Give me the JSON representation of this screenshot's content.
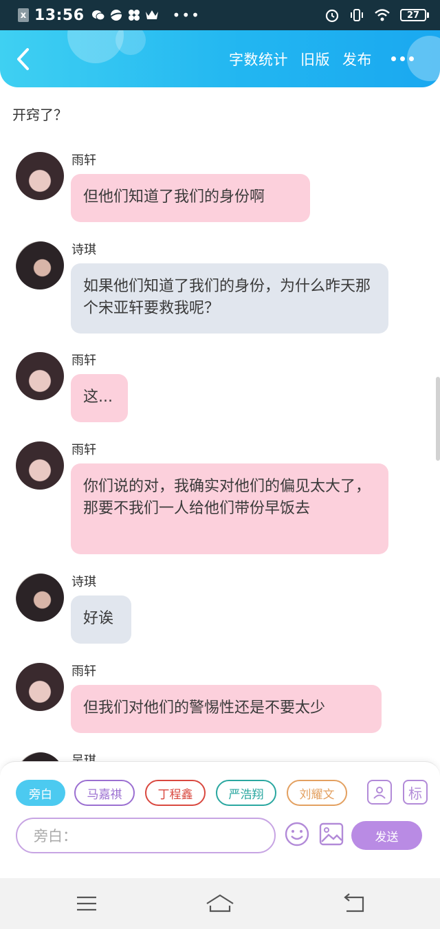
{
  "status_bar": {
    "time": "13:56",
    "battery": "27",
    "icons": [
      "close-box-icon",
      "wechat-icon",
      "planet-icon",
      "flower-icon",
      "crown-icon",
      "more-dots-icon",
      "alarm-icon",
      "vibrate-icon",
      "wifi-icon",
      "battery-icon"
    ]
  },
  "header": {
    "actions": [
      "字数统计",
      "旧版",
      "发布"
    ]
  },
  "chat": {
    "intro": "开窍了？",
    "messages": [
      {
        "sender": "雨轩",
        "text": "但他们知道了我们的身份啊",
        "style": "pink"
      },
      {
        "sender": "诗琪",
        "text": "如果他们知道了我们的身份，为什么昨天那个宋亚轩要救我呢？",
        "style": "gray"
      },
      {
        "sender": "雨轩",
        "text": "这...",
        "style": "pink"
      },
      {
        "sender": "雨轩",
        "text": "你们说的对，我确实对他们的偏见太大了，那要不我们一人给他们带份早饭去",
        "style": "pink"
      },
      {
        "sender": "诗琪",
        "text": "好诶",
        "style": "gray"
      },
      {
        "sender": "雨轩",
        "text": "但我们对他们的警惕性还是不要太少",
        "style": "pink"
      },
      {
        "sender": "吴琪",
        "text": "",
        "style": "gray"
      }
    ]
  },
  "composer": {
    "roles": [
      {
        "label": "旁白",
        "color": "#4ccaf0"
      },
      {
        "label": "马嘉祺",
        "color": "#9b6fd1"
      },
      {
        "label": "丁程鑫",
        "color": "#d9483f"
      },
      {
        "label": "严浩翔",
        "color": "#2aa7a0"
      },
      {
        "label": "刘耀文",
        "color": "#e3a060"
      }
    ],
    "tag_label": "标",
    "placeholder": "旁白：",
    "send_label": "发送"
  }
}
